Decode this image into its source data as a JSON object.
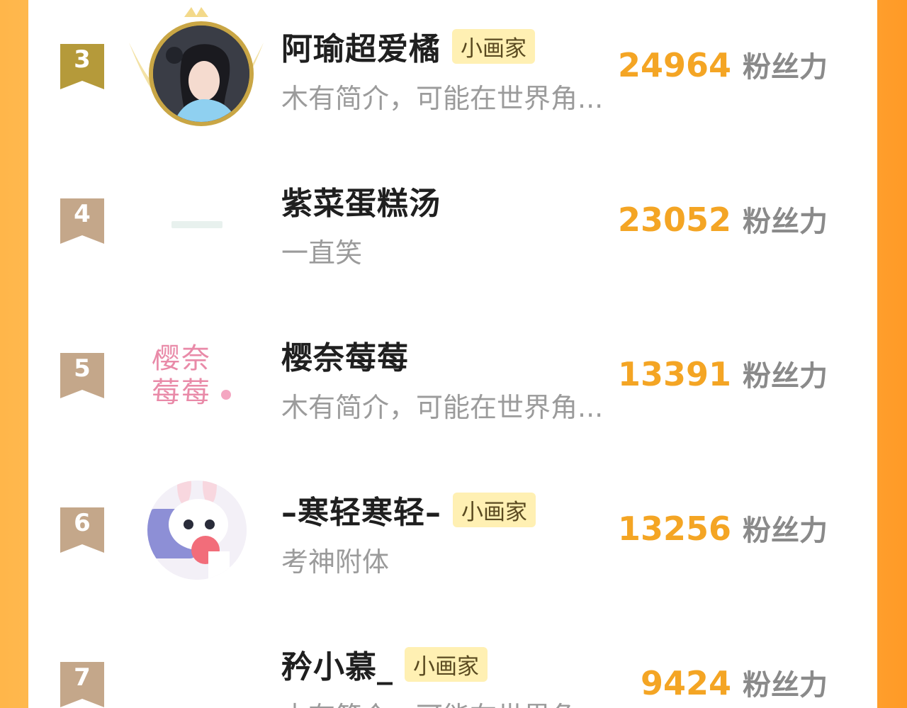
{
  "theme": {
    "accent": "#f4a524",
    "tag_bg": "#fff0b3",
    "badge_gold": "#b59a3a",
    "badge_bronze": "#c4a78a",
    "side_orange": "#ff9e2c"
  },
  "ranking": [
    {
      "rank": "3",
      "name": "阿瑜超爱橘",
      "tag": "小画家",
      "bio": "木有简介，可能在世界角...",
      "count": "24964",
      "unit": "粉丝力",
      "avatar": "crown-photo"
    },
    {
      "rank": "4",
      "name": "紫菜蛋糕汤",
      "tag": "",
      "bio": "一直笑",
      "count": "23052",
      "unit": "粉丝力",
      "avatar": "text-image"
    },
    {
      "rank": "5",
      "name": "樱奈莓莓",
      "tag": "",
      "bio": "木有简介，可能在世界角...",
      "count": "13391",
      "unit": "粉丝力",
      "avatar": "calligraphy"
    },
    {
      "rank": "6",
      "name": "–寒轻寒轻–",
      "tag": "小画家",
      "bio": "考神附体",
      "count": "13256",
      "unit": "粉丝力",
      "avatar": "bunny"
    },
    {
      "rank": "7",
      "name": "矜小慕_",
      "tag": "小画家",
      "bio": "木有简介，可能在世界角...",
      "count": "9424",
      "unit": "粉丝力",
      "avatar": "blank"
    }
  ],
  "avatar_text": {
    "row5": [
      "樱奈",
      "莓莓"
    ]
  }
}
